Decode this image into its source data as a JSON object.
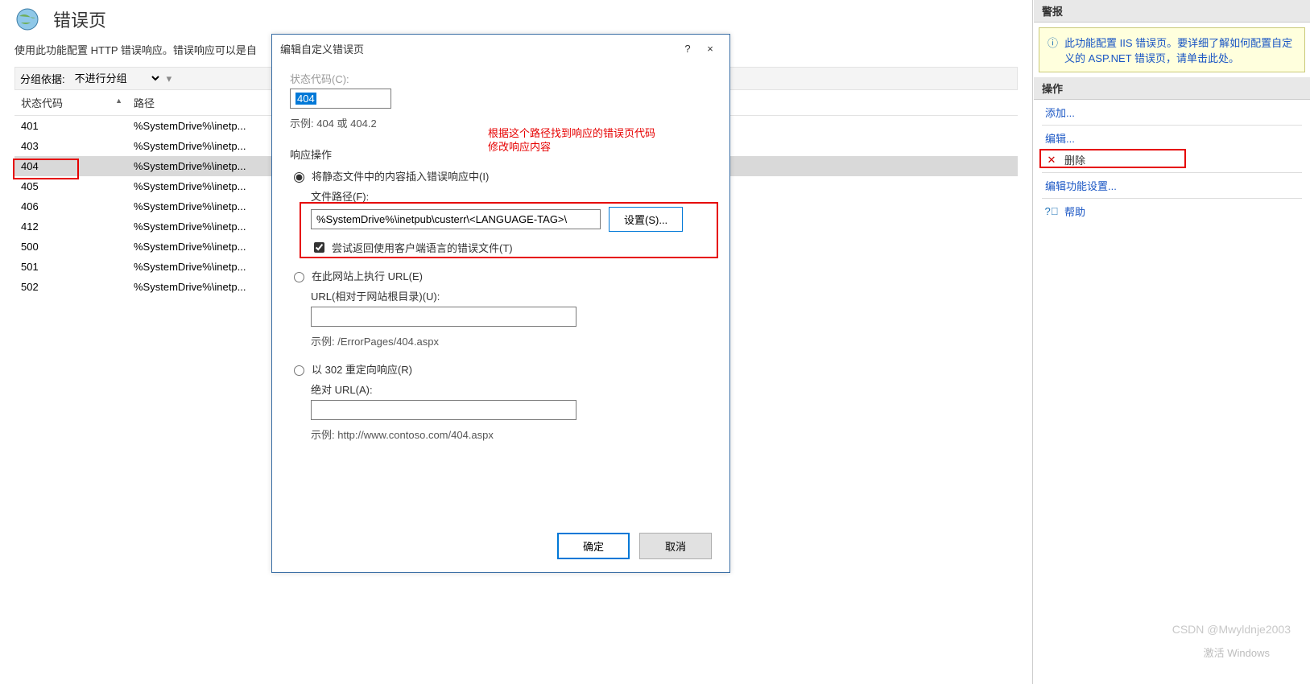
{
  "page": {
    "title": "错误页",
    "description": "使用此功能配置 HTTP 错误响应。错误响应可以是自"
  },
  "groupBar": {
    "label": "分组依据:",
    "value": "不进行分组"
  },
  "grid": {
    "columns": {
      "status": "状态代码",
      "path": "路径"
    },
    "rows": [
      {
        "code": "401",
        "path": "%SystemDrive%\\inetp..."
      },
      {
        "code": "403",
        "path": "%SystemDrive%\\inetp..."
      },
      {
        "code": "404",
        "path": "%SystemDrive%\\inetp...",
        "selected": true
      },
      {
        "code": "405",
        "path": "%SystemDrive%\\inetp..."
      },
      {
        "code": "406",
        "path": "%SystemDrive%\\inetp..."
      },
      {
        "code": "412",
        "path": "%SystemDrive%\\inetp..."
      },
      {
        "code": "500",
        "path": "%SystemDrive%\\inetp..."
      },
      {
        "code": "501",
        "path": "%SystemDrive%\\inetp..."
      },
      {
        "code": "502",
        "path": "%SystemDrive%\\inetp..."
      }
    ]
  },
  "dialog": {
    "title": "编辑自定义错误页",
    "help": "?",
    "close": "×",
    "statusLabel": "状态代码(C):",
    "statusValue": "404",
    "statusExample": "示例: 404 或 404.2",
    "respGroup": "响应操作",
    "opt1": "将静态文件中的内容插入错误响应中(I)",
    "filePathLabel": "文件路径(F):",
    "filePathValue": "%SystemDrive%\\inetpub\\custerr\\<LANGUAGE-TAG>\\",
    "setBtn": "设置(S)...",
    "chk": "尝试返回使用客户端语言的错误文件(T)",
    "opt2": "在此网站上执行 URL(E)",
    "urlLabel": "URL(相对于网站根目录)(U):",
    "urlExample": "示例: /ErrorPages/404.aspx",
    "opt3": "以 302 重定向响应(R)",
    "absLabel": "绝对 URL(A):",
    "absExample": "示例: http://www.contoso.com/404.aspx",
    "ok": "确定",
    "cancel": "取消"
  },
  "annotation": {
    "l1": "根据这个路径找到响应的错误页代码",
    "l2": "修改响应内容"
  },
  "right": {
    "alertsHead": "警报",
    "alertText": "此功能配置 IIS 错误页。要详细了解如何配置自定义的 ASP.NET 错误页，请单击此处。",
    "actionsHead": "操作",
    "add": "添加...",
    "edit": "编辑...",
    "delete": "删除",
    "editFeat": "编辑功能设置...",
    "help": "帮助"
  },
  "watermark": {
    "l1": "激活 Windows",
    "csdn": "CSDN @Mwyldnje2003"
  }
}
